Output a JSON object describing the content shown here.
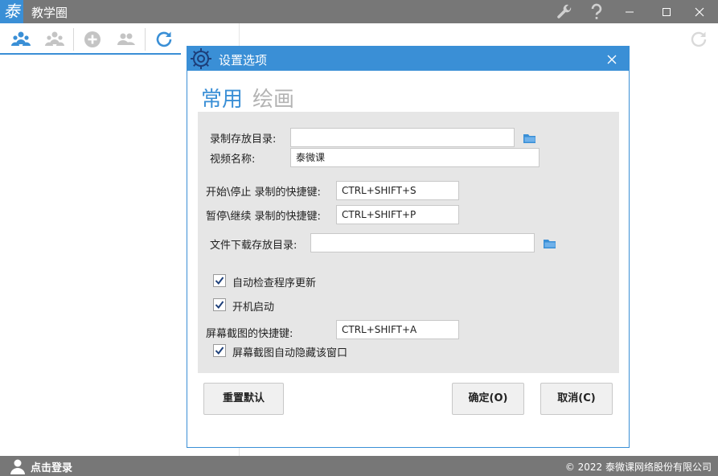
{
  "app": {
    "logo_char": "泰",
    "title": "教学圈"
  },
  "toolbar": {
    "icons": [
      "users-icon",
      "group-icon",
      "add-circle-icon",
      "contacts-icon",
      "refresh-icon"
    ]
  },
  "dialog": {
    "title": "设置选项",
    "tabs": [
      {
        "label": "常用",
        "active": true
      },
      {
        "label": "绘画",
        "active": false
      }
    ],
    "record_dir": {
      "label": "录制存放目录:",
      "value": ""
    },
    "video_name": {
      "label": "视频名称:",
      "value": "泰微课"
    },
    "start_stop_hotkey": {
      "label": "开始\\停止 录制的快捷键:",
      "value": "CTRL+SHIFT+S"
    },
    "pause_resume_hotkey": {
      "label": "暂停\\继续 录制的快捷键:",
      "value": "CTRL+SHIFT+P"
    },
    "download_dir": {
      "label": "文件下载存放目录:",
      "value": ""
    },
    "auto_update": {
      "label": "自动检查程序更新",
      "checked": true
    },
    "auto_start": {
      "label": "开机启动",
      "checked": true
    },
    "screenshot_hotkey": {
      "label": "屏幕截图的快捷键:",
      "value": "CTRL+SHIFT+A"
    },
    "hide_on_screenshot": {
      "label": "屏幕截图自动隐藏该窗口",
      "checked": true
    },
    "buttons": {
      "reset": "重置默认",
      "ok": "确定(O)",
      "cancel": "取消(C)"
    }
  },
  "statusbar": {
    "login": "点击登录",
    "copyright": "© 2022 泰微课网络股份有限公司"
  },
  "colors": {
    "accent": "#3a8fd6",
    "titlebar": "#777777",
    "panel": "#e6e6e6"
  }
}
